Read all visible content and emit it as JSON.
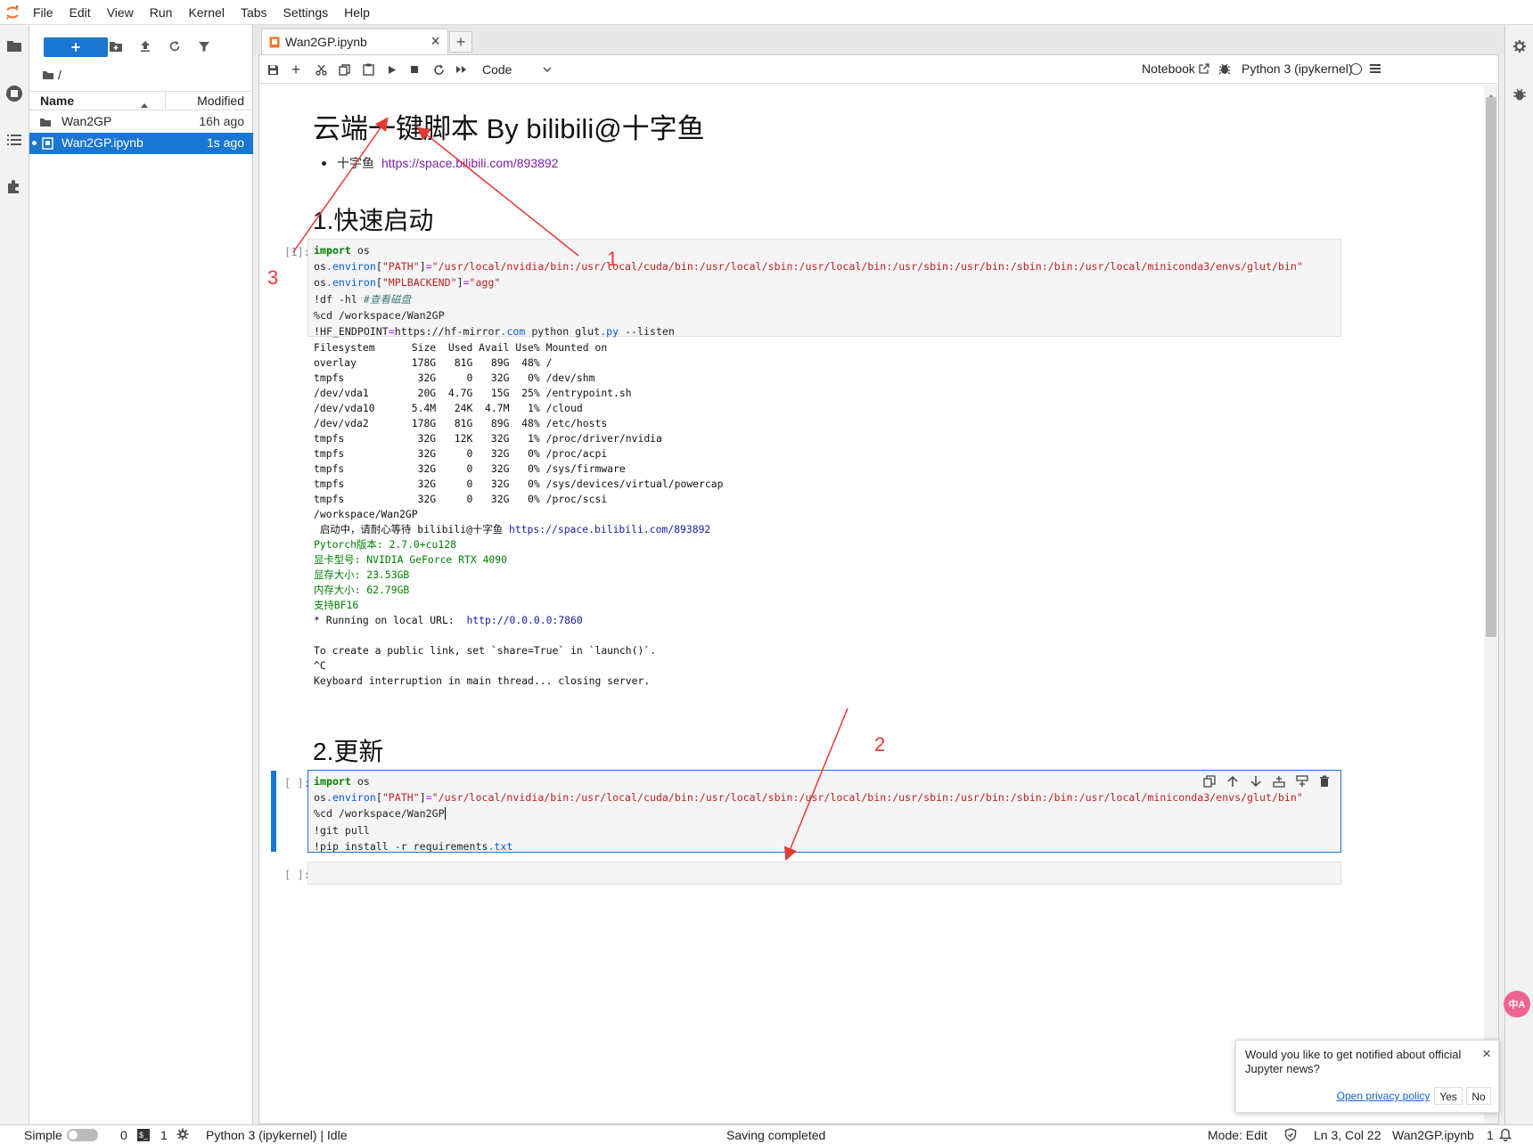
{
  "menu": [
    "File",
    "Edit",
    "View",
    "Run",
    "Kernel",
    "Tabs",
    "Settings",
    "Help"
  ],
  "filebrowser": {
    "breadcrumb": "/",
    "col_name": "Name",
    "col_modified": "Modified",
    "files": [
      {
        "name": "Wan2GP",
        "modified": "16h ago",
        "type": "folder"
      },
      {
        "name": "Wan2GP.ipynb",
        "modified": "1s ago",
        "type": "notebook",
        "selected": true
      }
    ]
  },
  "tab": {
    "title": "Wan2GP.ipynb"
  },
  "toolbar": {
    "cell_type": "Code",
    "notebook_label": "Notebook",
    "kernel_label": "Python 3 (ipykernel)"
  },
  "notebook": {
    "title": "云端一键脚本 By bilibili@十字鱼",
    "bullet_label": "十字鱼",
    "bullet_link": "https://space.bilibili.com/893892",
    "section1": "1.快速启动",
    "prompt1": "[1]:",
    "section2": "2.更新",
    "prompt2": "[ ]:",
    "prompt3": "[ ]:"
  },
  "annotations": [
    "1",
    "2",
    "3"
  ],
  "status": {
    "mode_label": "Simple",
    "terminals": "0",
    "kernels": "1",
    "kernel_status": "Python 3 (ipykernel) | Idle",
    "save_status": "Saving completed",
    "mode": "Mode: Edit",
    "position": "Ln 3, Col 22",
    "filename": "Wan2GP.ipynb",
    "notifications": "1"
  },
  "toast": {
    "message": "Would you like to get notified about official Jupyter news?",
    "privacy": "Open privacy policy",
    "yes": "Yes",
    "no": "No"
  },
  "colors": {
    "accent": "#1976d2",
    "annotation": "#e53935",
    "selection": "#1976d2"
  }
}
